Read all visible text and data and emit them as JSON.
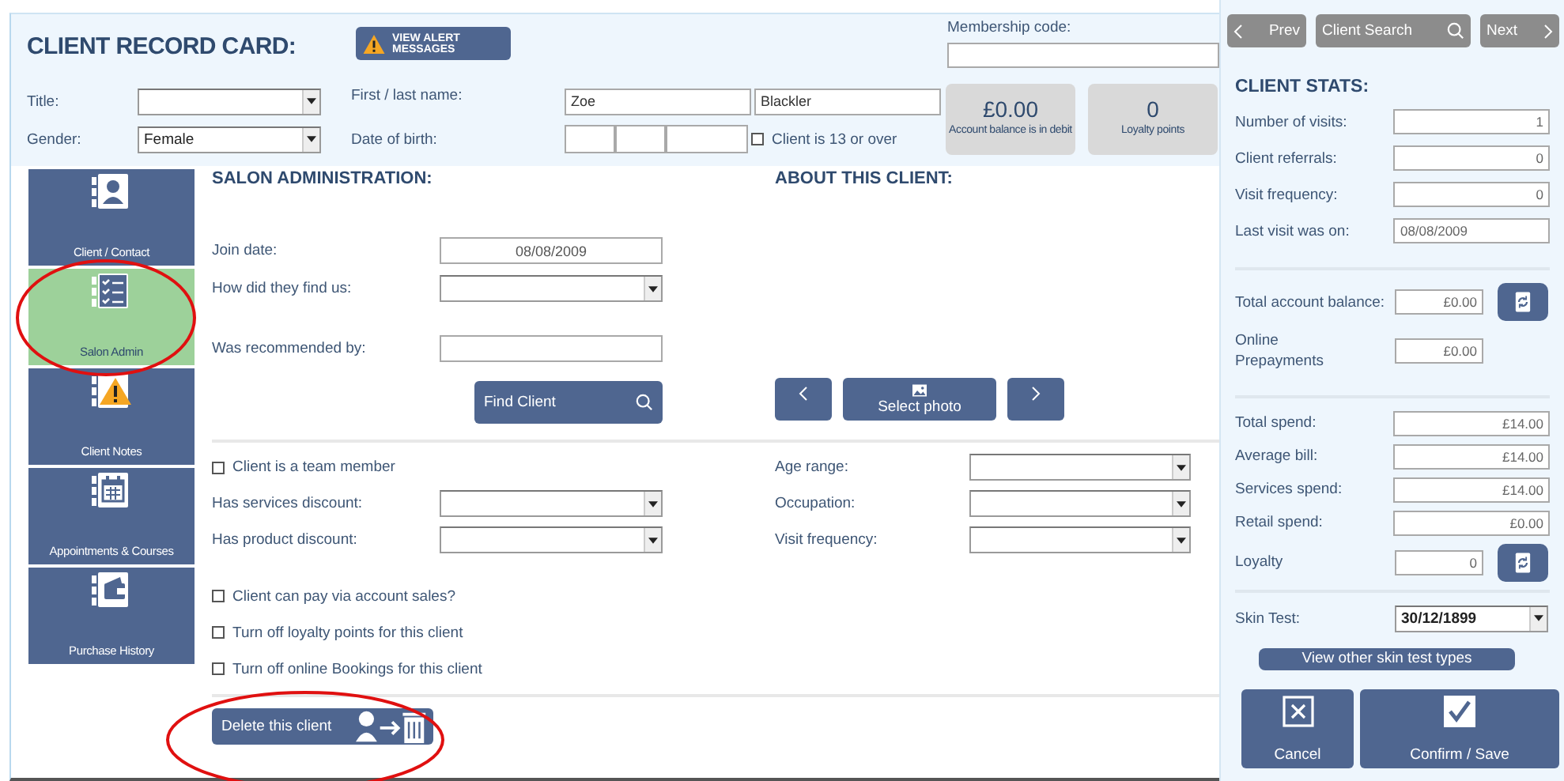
{
  "header": {
    "title": "CLIENT RECORD CARD:",
    "alert_button": "VIEW ALERT MESSAGES",
    "membership_label": "Membership code:",
    "title_label": "Title:",
    "gender_label": "Gender:",
    "gender_value": "Female",
    "name_label": "First / last name:",
    "first_name": "Zoe",
    "last_name": "Blackler",
    "dob_label": "Date of birth:",
    "over13": {
      "label": "Client is 13 or over",
      "checked": false
    },
    "tiles": [
      {
        "value": "£0.00",
        "caption": "Account balance is in debit"
      },
      {
        "value": "0",
        "caption": "Loyalty points"
      }
    ]
  },
  "nav": [
    {
      "label": "Client / Contact",
      "kind": "contact",
      "selected": false
    },
    {
      "label": "Salon Admin",
      "kind": "admin",
      "selected": true
    },
    {
      "label": "Client Notes",
      "kind": "notes",
      "selected": false
    },
    {
      "label": "Appointments & Courses",
      "kind": "appointments",
      "selected": false
    },
    {
      "label": "Purchase History",
      "kind": "purchases",
      "selected": false
    }
  ],
  "salon_admin": {
    "heading": "SALON ADMINISTRATION:",
    "fields": [
      {
        "kind": "input",
        "label": "Join date:",
        "value": "08/08/2009"
      },
      {
        "kind": "select",
        "label": "How did they find us:"
      },
      {
        "kind": "input",
        "label": "Was recommended by:"
      }
    ],
    "find_button": "Find Client"
  },
  "about": {
    "heading": "ABOUT THIS CLIENT:",
    "photo_button": "Select photo"
  },
  "team_member": {
    "label": "Client is a team member",
    "checked": false
  },
  "discounts": [
    {
      "label": "Has services discount:"
    },
    {
      "label": "Has product discount:"
    }
  ],
  "about_fields": [
    {
      "label": "Age range:"
    },
    {
      "label": "Occupation:"
    },
    {
      "label": "Visit frequency:"
    }
  ],
  "options": [
    {
      "label": "Client can pay via account sales?",
      "checked": false
    },
    {
      "label": "Turn off loyalty points for this client",
      "checked": false
    },
    {
      "label": "Turn off online Bookings for this client",
      "checked": false
    }
  ],
  "delete_button": "Delete this client",
  "stats": {
    "prev": "Prev",
    "search": "Client Search",
    "next": "Next",
    "heading": "CLIENT STATS:",
    "groups": [
      [
        {
          "label": "Number of visits:",
          "value": "1",
          "kind": "wide"
        },
        {
          "label": "Client referrals:",
          "value": "0",
          "kind": "wide"
        },
        {
          "label": "Visit frequency:",
          "value": "0",
          "kind": "wide"
        },
        {
          "label": "Last visit was on:",
          "value": "08/08/2009",
          "kind": "date"
        }
      ],
      [
        {
          "label": "Total account balance:",
          "value": "£0.00",
          "kind": "short-refresh"
        },
        {
          "label": "Online Prepayments",
          "value": "£0.00",
          "kind": "short"
        }
      ],
      [
        {
          "label": "Total spend:",
          "value": "£14.00",
          "kind": "wide"
        },
        {
          "label": "Average bill:",
          "value": "£14.00",
          "kind": "wide"
        },
        {
          "label": "Services spend:",
          "value": "£14.00",
          "kind": "wide"
        },
        {
          "label": "Retail spend:",
          "value": "£0.00",
          "kind": "wide"
        },
        {
          "label": "Loyalty",
          "value": "0",
          "kind": "short-refresh"
        }
      ]
    ],
    "skin_label": "Skin Test:",
    "skin_value": "30/12/1899",
    "skin_button": "View other skin test types",
    "cancel": "Cancel",
    "confirm": "Confirm / Save"
  }
}
